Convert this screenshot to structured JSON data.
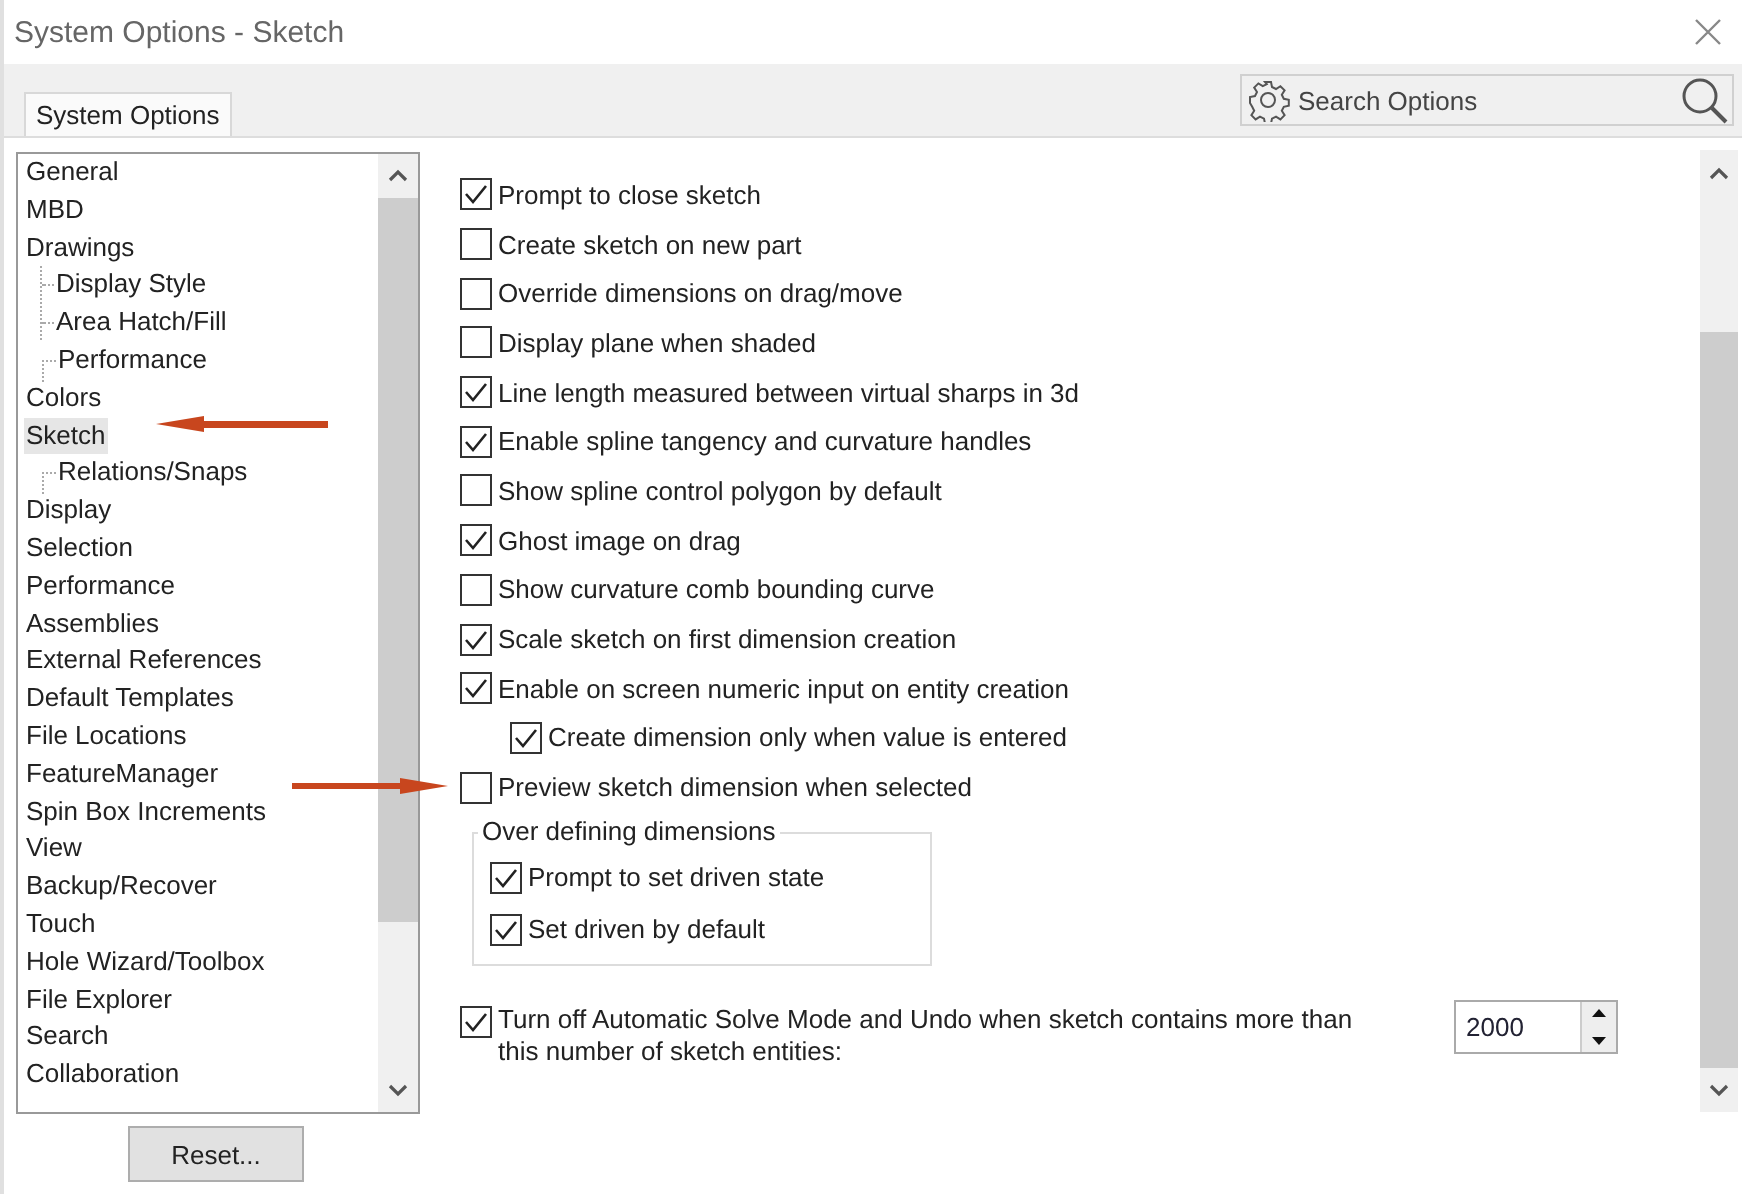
{
  "window": {
    "title": "System Options - Sketch"
  },
  "tabs": [
    {
      "label": "System Options",
      "selected": true
    }
  ],
  "search": {
    "placeholder": "Search Options"
  },
  "categories": [
    {
      "label": "General",
      "selected": false
    },
    {
      "label": "MBD",
      "selected": false
    },
    {
      "label": "Drawings",
      "selected": false,
      "children": [
        {
          "label": "Display Style",
          "selected": false
        },
        {
          "label": "Area Hatch/Fill",
          "selected": false
        },
        {
          "label": "Performance",
          "selected": false
        }
      ]
    },
    {
      "label": "Colors",
      "selected": false
    },
    {
      "label": "Sketch",
      "selected": true,
      "children": [
        {
          "label": "Relations/Snaps",
          "selected": false
        }
      ]
    },
    {
      "label": "Display",
      "selected": false
    },
    {
      "label": "Selection",
      "selected": false
    },
    {
      "label": "Performance",
      "selected": false
    },
    {
      "label": "Assemblies",
      "selected": false
    },
    {
      "label": "External References",
      "selected": false
    },
    {
      "label": "Default Templates",
      "selected": false
    },
    {
      "label": "File Locations",
      "selected": false
    },
    {
      "label": "FeatureManager",
      "selected": false
    },
    {
      "label": "Spin Box Increments",
      "selected": false
    },
    {
      "label": "View",
      "selected": false
    },
    {
      "label": "Backup/Recover",
      "selected": false
    },
    {
      "label": "Touch",
      "selected": false
    },
    {
      "label": "Hole Wizard/Toolbox",
      "selected": false
    },
    {
      "label": "File Explorer",
      "selected": false
    },
    {
      "label": "Search",
      "selected": false
    },
    {
      "label": "Collaboration",
      "selected": false
    }
  ],
  "options": [
    {
      "kind": "checkbox",
      "label": "Prompt to close sketch",
      "checked": true
    },
    {
      "kind": "checkbox",
      "label": "Create sketch on new part",
      "checked": false
    },
    {
      "kind": "checkbox",
      "label": "Override dimensions on drag/move",
      "checked": false
    },
    {
      "kind": "checkbox",
      "label": "Display plane when shaded",
      "checked": false
    },
    {
      "kind": "checkbox",
      "label": "Line length measured between virtual sharps in 3d",
      "checked": true
    },
    {
      "kind": "checkbox",
      "label": "Enable spline tangency and curvature handles",
      "checked": true
    },
    {
      "kind": "checkbox",
      "label": "Show spline control polygon by default",
      "checked": false
    },
    {
      "kind": "checkbox",
      "label": "Ghost image on drag",
      "checked": true
    },
    {
      "kind": "checkbox",
      "label": "Show curvature comb bounding curve",
      "checked": false
    },
    {
      "kind": "checkbox",
      "label": "Scale sketch on first dimension creation",
      "checked": true
    },
    {
      "kind": "checkbox",
      "label": "Enable on screen numeric input on entity creation",
      "checked": true,
      "children": [
        {
          "label": "Create dimension only when value is entered",
          "checked": true
        }
      ]
    },
    {
      "kind": "checkbox",
      "label": "Preview sketch dimension when selected",
      "checked": false
    },
    {
      "kind": "group",
      "title": "Over defining dimensions",
      "items": [
        {
          "label": "Prompt to set driven state",
          "checked": true
        },
        {
          "label": "Set driven by default",
          "checked": true
        }
      ]
    },
    {
      "kind": "spin",
      "label": "Turn off Automatic Solve Mode and Undo when sketch contains more than this number of sketch entities:",
      "checked": true,
      "value": "2000"
    }
  ],
  "reset_button": {
    "label": "Reset..."
  }
}
